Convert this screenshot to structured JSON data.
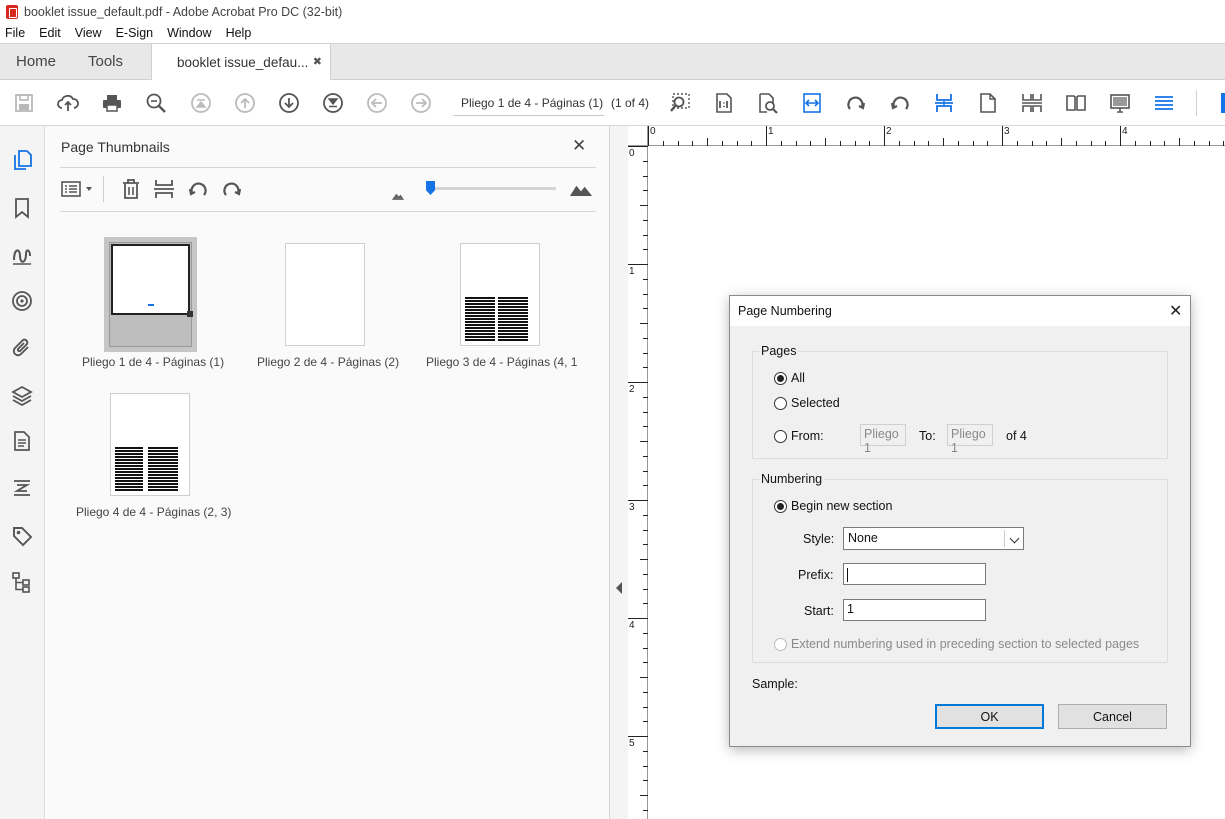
{
  "window": {
    "title": "booklet issue_default.pdf - Adobe Acrobat Pro DC (32-bit)"
  },
  "menu": [
    "File",
    "Edit",
    "View",
    "E-Sign",
    "Window",
    "Help"
  ],
  "tabs": {
    "home": "Home",
    "tools": "Tools",
    "document": "booklet issue_defau..."
  },
  "toolbar": {
    "page_field": "Pliego 1 de 4 - Páginas (1)",
    "page_count": "(1 of 4)"
  },
  "panel": {
    "title": "Page Thumbnails",
    "thumbnails": [
      {
        "label": "Pliego 1 de 4 - Páginas (1)"
      },
      {
        "label": "Pliego 2 de 4 - Páginas (2)"
      },
      {
        "label": "Pliego 3 de 4 - Páginas (4, 1"
      },
      {
        "label": "Pliego 4 de 4 - Páginas (2, 3)"
      }
    ]
  },
  "ruler": {
    "top": [
      "0",
      "1",
      "2",
      "3",
      "4"
    ],
    "left": [
      "0",
      "1",
      "2",
      "3",
      "4",
      "5"
    ]
  },
  "dialog": {
    "title": "Page Numbering",
    "pages": {
      "label": "Pages",
      "all": "All",
      "selected": "Selected",
      "from": "From:",
      "from_value": "Pliego 1",
      "to": "To:",
      "to_value": "Pliego 1",
      "of": "of 4",
      "selection": "All"
    },
    "numbering": {
      "label": "Numbering",
      "begin_new": "Begin new section",
      "style_label": "Style:",
      "style_value": "None",
      "prefix_label": "Prefix:",
      "prefix_value": "",
      "start_label": "Start:",
      "start_value": "1",
      "extend": "Extend numbering used in preceding section to selected pages"
    },
    "sample_label": "Sample:",
    "ok": "OK",
    "cancel": "Cancel"
  },
  "colors": {
    "accent": "#1473e6",
    "pdf_red": "#d8271c",
    "ok_border": "#0078d7"
  }
}
